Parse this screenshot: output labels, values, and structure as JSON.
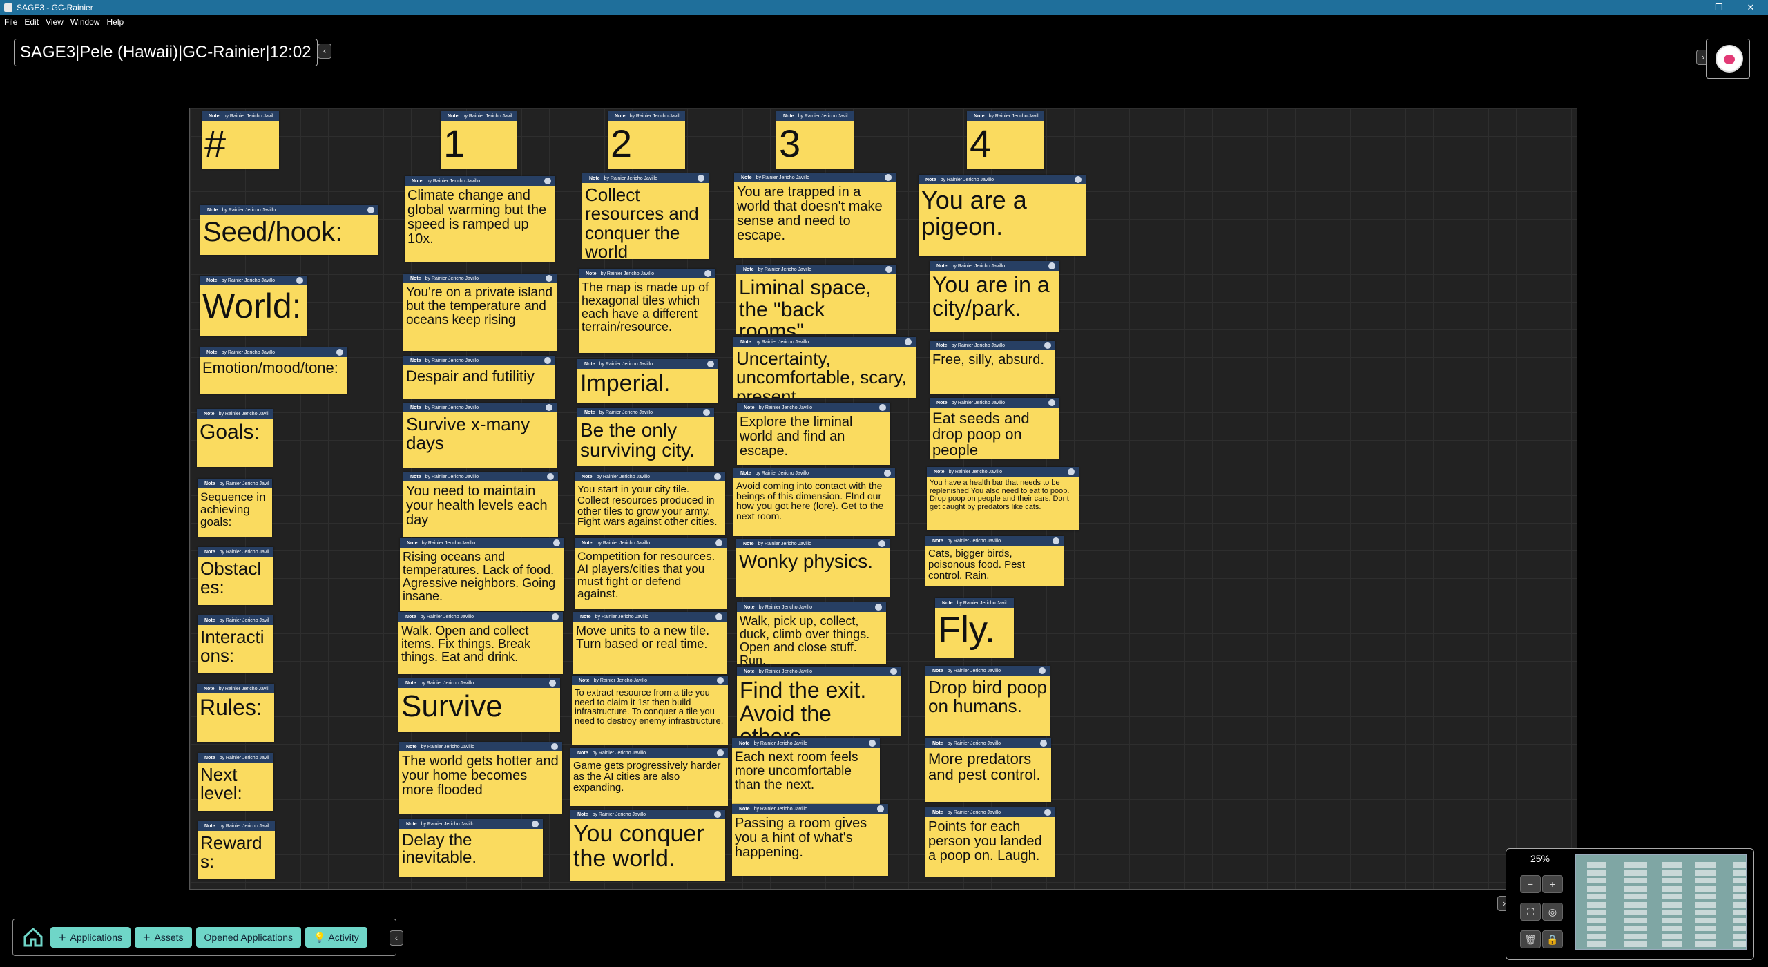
{
  "window": {
    "title": "SAGE3 - GC-Rainier"
  },
  "menu": [
    "File",
    "Edit",
    "View",
    "Window",
    "Help"
  ],
  "board": {
    "title": "SAGE3|Pele (Hawaii)|GC-Rainier|12:02"
  },
  "note_header": {
    "type": "Note",
    "author_full": "by Rainier Jericho Javillo",
    "author_short": "by Rainier Jericho Javil"
  },
  "notes": {
    "n_hash": "#",
    "n_1": "1",
    "n_2": "2",
    "n_3": "3",
    "n_4": "4",
    "r_seed": "Seed/hook:",
    "r_world": "World:",
    "r_emotion": "Emotion/mood/tone:",
    "r_goals": "Goals:",
    "r_sequence": "Sequence in achieving goals:",
    "r_obstacles": "Obstacl es:",
    "r_interactions": "Interacti ons:",
    "r_rules": "Rules:",
    "r_next": "Next level:",
    "r_reward": "Reward s:",
    "c1_seed": "Climate change and global warming but the speed is ramped up 10x.",
    "c1_world": "You're on a private island but the temperature and oceans keep rising",
    "c1_emotion": "Despair and futilitiy",
    "c1_goals": "Survive x-many days",
    "c1_sequence": "You need to maintain your health levels each day",
    "c1_obstacles": "Rising oceans and temperatures. Lack of food. Agressive neighbors. Going insane.",
    "c1_interactions": "Walk. Open and collect items. Fix things. Break things. Eat and drink.",
    "c1_rules": "Survive",
    "c1_next": "The world gets hotter and your home becomes more flooded",
    "c1_reward": "Delay the inevitable.",
    "c2_seed": "Collect resources and conquer the world",
    "c2_world": "The map is made up of hexagonal tiles which each have a different terrain/resource.",
    "c2_emotion": "Imperial.",
    "c2_goals": "Be the only surviving city.",
    "c2_sequence": "You start in your city tile. Collect resources produced in other tiles to grow your army. Fight wars against other cities.",
    "c2_obstacles": "Competition for resources. AI players/cities that you must fight or defend against.",
    "c2_interactions": "Move units to a new tile. Turn based or real time.",
    "c2_rules": "To extract resource from a tile you need to claim it 1st then build infrastructure. To conquer a tile you need to destroy enemy infrastructure.",
    "c2_next": "Game gets progressively harder as the AI cities are also expanding.",
    "c2_reward": "You conquer the world.",
    "c3_seed": "You are trapped in a world that doesn't make sense and need to escape.",
    "c3_world": "Liminal space, the \"back rooms\"",
    "c3_emotion": "Uncertainty, uncomfortable, scary, present",
    "c3_goals": "Explore the liminal world and find an escape.",
    "c3_sequence": "Avoid coming into contact with the beings of this dimension. FInd our how you got here (lore). Get to the next room.",
    "c3_obstacles": "Wonky physics.",
    "c3_interactions": "Walk, pick up, collect, duck, climb over things. Open and close stuff. Run.",
    "c3_rules": "Find the exit. Avoid the others.",
    "c3_next": "Each next room feels more uncomfortable than the next.",
    "c3_reward": "Passing a room gives you a hint of what's happening.",
    "c4_seed": "You are a pigeon.",
    "c4_world": "You are in a city/park.",
    "c4_emotion": "Free, silly, absurd.",
    "c4_goals": "Eat seeds and drop poop on people",
    "c4_sequence": "You have a health bar that needs to be replenished You also need to eat to poop. Drop poop on people and their cars. Dont get caught by predators like cats.",
    "c4_obstacles": "Cats, bigger birds, poisonous food. Pest control. Rain.",
    "c4_interactions": "Fly.",
    "c4_rules": "Drop bird poop on humans.",
    "c4_next": "More predators and pest control.",
    "c4_reward": "Points for each person you landed a poop on. Laugh."
  },
  "toolbar": {
    "applications": "Applications",
    "assets": "Assets",
    "opened": "Opened Applications",
    "activity": "Activity"
  },
  "navigator": {
    "zoom": "25%"
  },
  "colors": {
    "note": "#fadb5f",
    "note_header": "#273f63",
    "board": "#222222",
    "titlebar": "#1f6f9b",
    "button": "#6fd6c8"
  }
}
